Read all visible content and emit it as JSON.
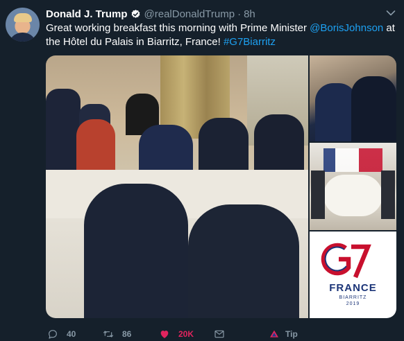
{
  "tweet": {
    "display_name": "Donald J. Trump",
    "handle": "@realDonaldTrump",
    "separator": "·",
    "time": "8h",
    "text_before": "Great working breakfast this morning with Prime Minister ",
    "mention": "@BorisJohnson",
    "text_middle": " at the Hôtel du Palais in Biarritz, France! ",
    "hashtag": "#G7Biarritz",
    "verified": true
  },
  "media": {
    "logo": {
      "mark": "G7",
      "country": "FRANCE",
      "city": "BIARRITZ",
      "year": "2019"
    }
  },
  "actions": {
    "reply_count": "40",
    "retweet_count": "86",
    "like_count": "20K",
    "liked": true,
    "tip_label": "Tip"
  },
  "colors": {
    "background": "#15202b",
    "link": "#1da1f2",
    "muted": "#8899a6",
    "like": "#e0245e"
  },
  "icons": [
    "verified-badge-icon",
    "chevron-down-icon",
    "reply-icon",
    "retweet-icon",
    "like-icon",
    "dm-envelope-icon",
    "tip-icon"
  ]
}
